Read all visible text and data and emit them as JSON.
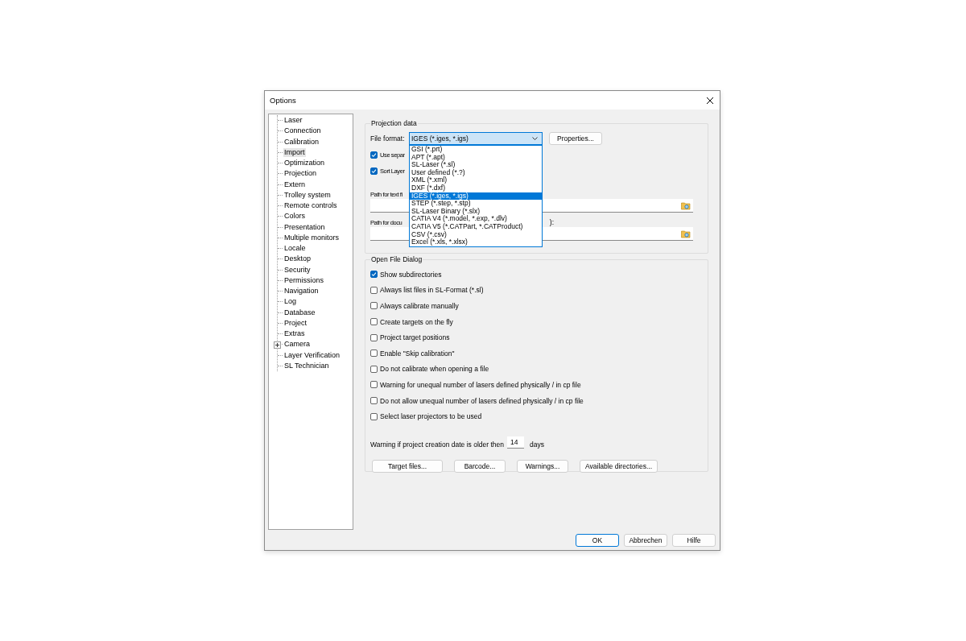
{
  "window": {
    "title": "Options"
  },
  "tree": [
    {
      "label": "Laser",
      "kind": "leaf",
      "selected": false
    },
    {
      "label": "Connection",
      "kind": "leaf",
      "selected": false
    },
    {
      "label": "Calibration",
      "kind": "leaf",
      "selected": false
    },
    {
      "label": "Import",
      "kind": "leaf",
      "selected": true
    },
    {
      "label": "Optimization",
      "kind": "leaf",
      "selected": false
    },
    {
      "label": "Projection",
      "kind": "leaf",
      "selected": false
    },
    {
      "label": "Extern",
      "kind": "leaf",
      "selected": false
    },
    {
      "label": "Trolley system",
      "kind": "leaf",
      "selected": false
    },
    {
      "label": "Remote controls",
      "kind": "leaf",
      "selected": false
    },
    {
      "label": "Colors",
      "kind": "leaf",
      "selected": false
    },
    {
      "label": "Presentation",
      "kind": "leaf",
      "selected": false
    },
    {
      "label": "Multiple monitors",
      "kind": "leaf",
      "selected": false
    },
    {
      "label": "Locale",
      "kind": "leaf",
      "selected": false
    },
    {
      "label": "Desktop",
      "kind": "leaf",
      "selected": false
    },
    {
      "label": "Security",
      "kind": "leaf",
      "selected": false
    },
    {
      "label": "Permissions",
      "kind": "leaf",
      "selected": false
    },
    {
      "label": "Navigation",
      "kind": "leaf",
      "selected": false
    },
    {
      "label": "Log",
      "kind": "leaf",
      "selected": false
    },
    {
      "label": "Database",
      "kind": "leaf",
      "selected": false
    },
    {
      "label": "Project",
      "kind": "leaf",
      "selected": false
    },
    {
      "label": "Extras",
      "kind": "leaf",
      "selected": false
    },
    {
      "label": "Camera",
      "kind": "node",
      "expanded": false,
      "selected": false
    },
    {
      "label": "Layer Verification",
      "kind": "leaf",
      "selected": false
    },
    {
      "label": "SL Technician",
      "kind": "leaf",
      "selected": false
    }
  ],
  "projection_data": {
    "title": "Projection data",
    "file_format": {
      "label": "File format:",
      "value": "IGES (*.iges, *.igs)",
      "expanded": true,
      "options": [
        {
          "label": "GSI (*.prt)",
          "selected": false
        },
        {
          "label": "APT (*.apt)",
          "selected": false
        },
        {
          "label": "SL-Laser (*.sl)",
          "selected": false
        },
        {
          "label": "User defined (*.?)",
          "selected": false
        },
        {
          "label": "XML (*.xml)",
          "selected": false
        },
        {
          "label": "DXF (*.dxf)",
          "selected": false
        },
        {
          "label": "IGES (*.iges, *.igs)",
          "selected": true
        },
        {
          "label": "STEP (*.step, *.stp)",
          "selected": false
        },
        {
          "label": "SL-Laser Binary (*.slx)",
          "selected": false
        },
        {
          "label": "CATIA V4 (*.model, *.exp, *.dlv)",
          "selected": false
        },
        {
          "label": "CATIA V5 (*.CATPart, *.CATProduct)",
          "selected": false
        },
        {
          "label": "CSV (*.csv)",
          "selected": false
        },
        {
          "label": "Excel (*.xls, *.xlsx)",
          "selected": false
        }
      ]
    },
    "properties_button": "Properties...",
    "checkboxes": [
      {
        "label": "Use separ",
        "checked": true
      },
      {
        "label": "Sort Layer",
        "checked": true
      }
    ],
    "paths": [
      {
        "label": "Path for text fi"
      },
      {
        "label": "Path for docu",
        "suffix": "):"
      }
    ]
  },
  "open_file_dialog": {
    "title": "Open File  Dialog",
    "checkboxes": [
      {
        "label": "Show subdirectories",
        "checked": true
      },
      {
        "label": "Always list files in SL-Format (*.sl)",
        "checked": false
      },
      {
        "label": "Always calibrate manually",
        "checked": false
      },
      {
        "label": "Create targets on the fly",
        "checked": false
      },
      {
        "label": "Project target positions",
        "checked": false
      },
      {
        "label": "Enable \"Skip calibration\"",
        "checked": false
      },
      {
        "label": "Do not calibrate when opening a file",
        "checked": false
      },
      {
        "label": "Warning for unequal number of lasers defined physically / in cp file",
        "checked": false
      },
      {
        "label": "Do not allow unequal number of lasers defined physically / in cp file",
        "checked": false
      },
      {
        "label": "Select laser projectors to be used",
        "checked": false
      }
    ],
    "age_warning": {
      "prefix": "Warning if project creation date is older then",
      "value": "14",
      "suffix": "days"
    },
    "buttons": [
      "Target files...",
      "Barcode...",
      "Warnings...",
      "Available directories..."
    ]
  },
  "buttons": [
    {
      "label": "OK",
      "default": true
    },
    {
      "label": "Abbrechen",
      "default": false
    },
    {
      "label": "Hilfe",
      "default": false
    }
  ]
}
